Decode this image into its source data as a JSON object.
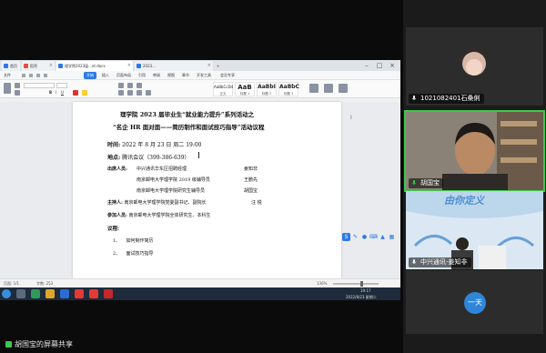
{
  "browser": {
    "tabs": [
      {
        "label": "首页"
      },
      {
        "label": "稻壳"
      },
      {
        "label": "理学院2023届...xt.docx"
      },
      {
        "label": "2023..."
      }
    ]
  },
  "wps": {
    "menus": [
      "文件",
      "开始",
      "插入",
      "页面布局",
      "引用",
      "审阅",
      "视图",
      "章节",
      "开发工具",
      "会员专享"
    ],
    "styles": [
      {
        "sample": "AaBbCcDd",
        "caption": "正文"
      },
      {
        "sample": "AaB",
        "caption": "标题 1"
      },
      {
        "sample": "AaBbI",
        "caption": "标题 2"
      },
      {
        "sample": "AaBbC",
        "caption": "标题 3"
      }
    ],
    "status": {
      "page": "页面: 1/1",
      "words": "字数: 253",
      "zoom": "136%"
    }
  },
  "document": {
    "title_line1": "理学院 2023 届毕业生“就业能力提升”系列活动之",
    "title_line2": "“名企 HR 面对面——简历制作和面试技巧指导”活动议程",
    "time_label": "时间:",
    "time_value": "2022 年 8 月 23 日  周二 19:00",
    "place_label": "地点:",
    "place_value": "腾讯会议（399-386-639）",
    "attendees_label": "出席人员:",
    "attendees": [
      {
        "org": "中兴通讯华东区招聘经理",
        "name": "姜知非"
      },
      {
        "org": "南京邮电大学理学院 2019 级辅导员",
        "name": "王鹏先"
      },
      {
        "org": "南京邮电大学理学院研究生辅导员",
        "name": "胡国宝"
      }
    ],
    "host_label": "主持人:",
    "host_value": "南京邮电大学理学院党委副书记、副院长",
    "host_name": "汪  锐",
    "participants_label": "参加人员:",
    "participants_value": "南京邮电大学理学院全体研究生、本科生",
    "agenda_label": "议程:",
    "agenda": [
      {
        "num": "1、",
        "text": "如何制作简历"
      },
      {
        "num": "2、",
        "text": "面试技巧指导"
      }
    ]
  },
  "taskbar": {
    "time": "19:17",
    "date": "2022/8/23 星期二"
  },
  "participants": [
    {
      "name": "1021082401石桑俐",
      "speaking": false
    },
    {
      "name": "胡国宝",
      "speaking": true
    },
    {
      "name": "中兴通讯-姜知非",
      "speaking": false
    },
    {
      "name": "一天",
      "speaking": false
    }
  ],
  "banner": {
    "text": "由你定义"
  },
  "share_label": "胡国宝的屏幕共享",
  "colors": {
    "accent": "#2b79e8",
    "speaking": "#3ec84b",
    "avatar_yitian": "#2f86d9"
  }
}
